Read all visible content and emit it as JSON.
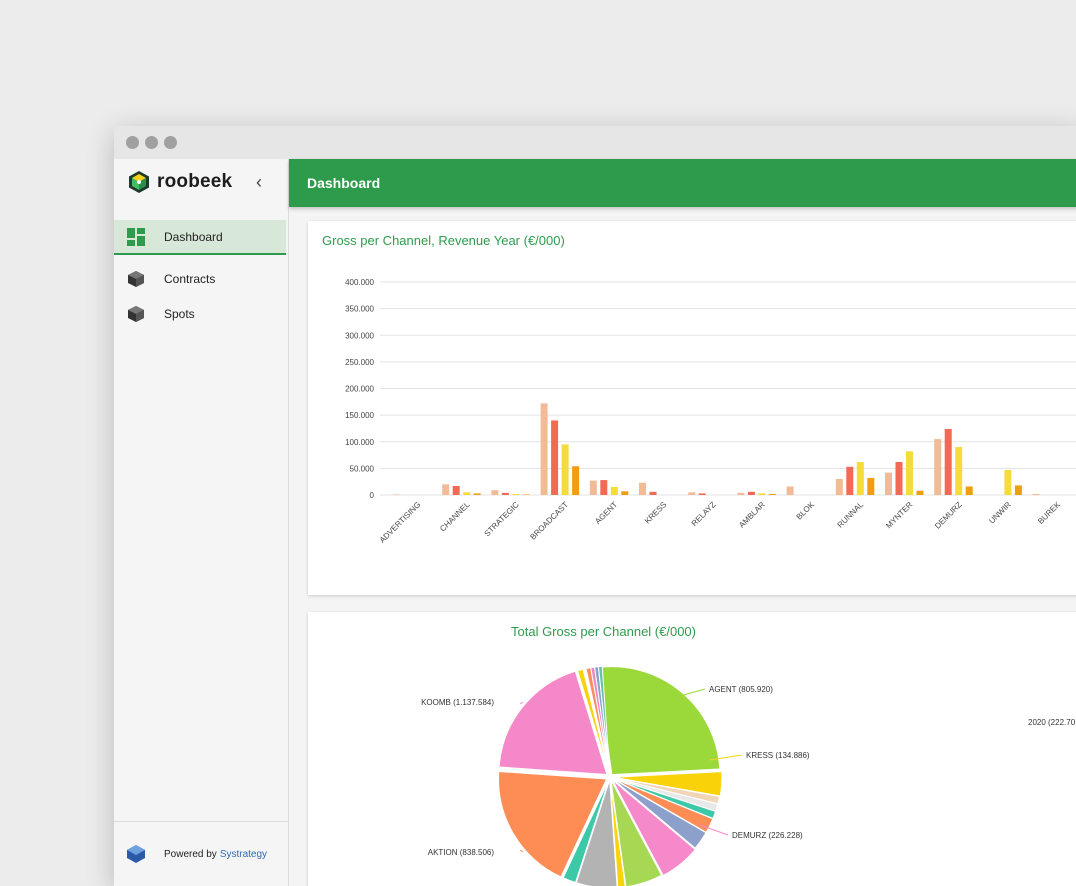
{
  "app": {
    "logo_text": "roobeek",
    "collapse_glyph": "‹",
    "header_title": "Dashboard"
  },
  "sidebar": {
    "items": [
      {
        "label": "Dashboard",
        "icon": "dashboard-grid-icon",
        "active": true
      },
      {
        "label": "Contracts",
        "icon": "box-icon",
        "active": false
      },
      {
        "label": "Spots",
        "icon": "box-icon",
        "active": false
      }
    ],
    "footer": {
      "prefix": "Powered by",
      "brand": "Systrategy"
    }
  },
  "colors": {
    "brand_green": "#2e9b4c",
    "series": [
      "#f2bb97",
      "#f26a55",
      "#f5dc3a",
      "#ef9e10"
    ]
  },
  "chart_data": [
    {
      "type": "bar",
      "title": "Gross per Channel, Revenue Year (€/000)",
      "ylim": [
        0,
        400000
      ],
      "yticks": [
        "0",
        "50.000",
        "100.000",
        "150.000",
        "200.000",
        "250.000",
        "300.000",
        "350.000",
        "400.000"
      ],
      "categories": [
        "ADVERTISING",
        "CHANNEL",
        "STRATEGIC",
        "BROADCAST",
        "AGENT",
        "KRESS",
        "RELAYZ",
        "AMBLAR",
        "BLOK",
        "RUNNAL",
        "MYNTER",
        "DEMURZ",
        "UNWIR",
        "BUREK"
      ],
      "grid": true,
      "series": [
        {
          "values": [
            1000,
            20000,
            9000,
            172000,
            27000,
            23000,
            5000,
            4000,
            16000,
            30000,
            42000,
            105000,
            0,
            2000
          ]
        },
        {
          "values": [
            0,
            17000,
            4000,
            140000,
            28000,
            6000,
            3000,
            6000,
            0,
            53000,
            62000,
            124000,
            0,
            0
          ]
        },
        {
          "values": [
            0,
            5000,
            2000,
            95000,
            15000,
            0,
            0,
            3000,
            0,
            62000,
            82000,
            90000,
            47000,
            0
          ]
        },
        {
          "values": [
            0,
            3000,
            1000,
            54000,
            7000,
            0,
            0,
            2000,
            0,
            32000,
            8000,
            16000,
            18000,
            0
          ]
        }
      ]
    },
    {
      "type": "pie",
      "title": "Total Gross per Channel (€/000)",
      "slices": [
        {
          "label": "KOOMB (1.137.584)",
          "value": 1137584,
          "color": "#f588c8"
        },
        {
          "label": "AGENT (805.920)",
          "value": 805920,
          "color": "#9bd93a"
        },
        {
          "label": "KRESS (134.886)",
          "value": 134886,
          "color": "#fad20a"
        },
        {
          "label": "DEMURZ (226.228)",
          "value": 226228,
          "color": "#f589c9"
        },
        {
          "label": "AKTION (838.506)",
          "value": 838506,
          "color": "#fd8c55"
        }
      ],
      "other_label": "2020 (222.70"
    }
  ]
}
